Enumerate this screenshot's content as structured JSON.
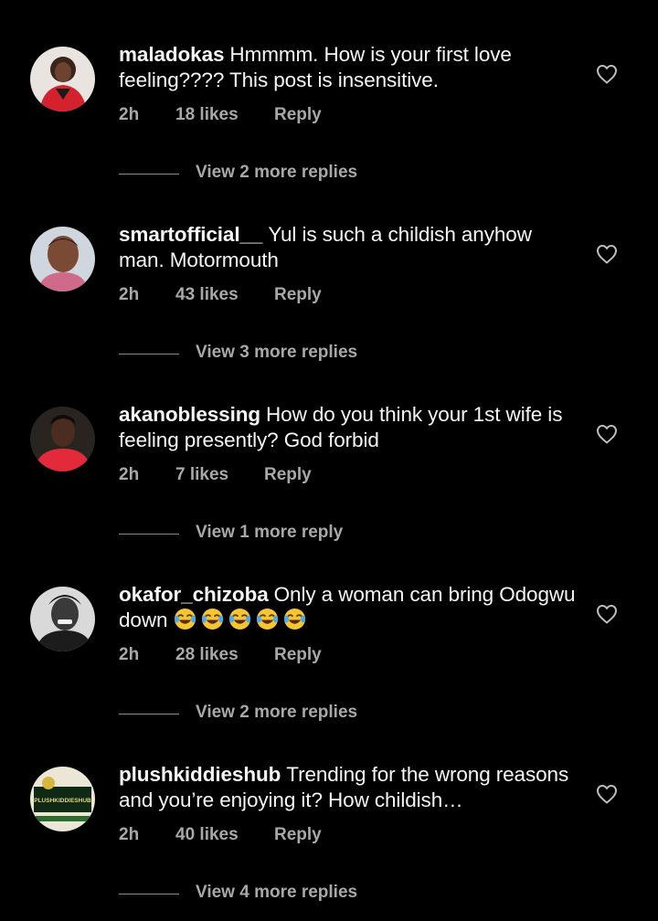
{
  "comments": [
    {
      "username": "maladokas",
      "text": "Hmmmm. How is your first love feeling???? This post is insensitive.",
      "time": "2h",
      "likes": "18 likes",
      "reply": "Reply",
      "view_replies": "View 2 more replies"
    },
    {
      "username": "smartofficial__",
      "text": "Yul is such a childish anyhow man. Motormouth",
      "time": "2h",
      "likes": "43 likes",
      "reply": "Reply",
      "view_replies": "View 3 more replies"
    },
    {
      "username": "akanoblessing",
      "text": "How do you think your 1st wife is feeling presently? God forbid",
      "time": "2h",
      "likes": "7 likes",
      "reply": "Reply",
      "view_replies": "View 1 more reply"
    },
    {
      "username": "okafor_chizoba",
      "text": "Only a woman can bring Odogwu down",
      "emoji": "😂😂😂😂😂",
      "time": "2h",
      "likes": "28 likes",
      "reply": "Reply",
      "view_replies": "View 2 more replies"
    },
    {
      "username": "plushkiddieshub",
      "text": "Trending for the wrong reasons and you’re enjoying it? How childish…",
      "time": "2h",
      "likes": "40 likes",
      "reply": "Reply",
      "view_replies": "View 4 more replies"
    }
  ],
  "avatar_logo_text": "PLUSHKIDDIESHUB",
  "colors": {
    "background": "#000000",
    "text": "#f5f5f5",
    "secondary_text": "#a8a8a8"
  },
  "icons": [
    "heart-icon",
    "face-with-tears-of-joy-emoji"
  ]
}
